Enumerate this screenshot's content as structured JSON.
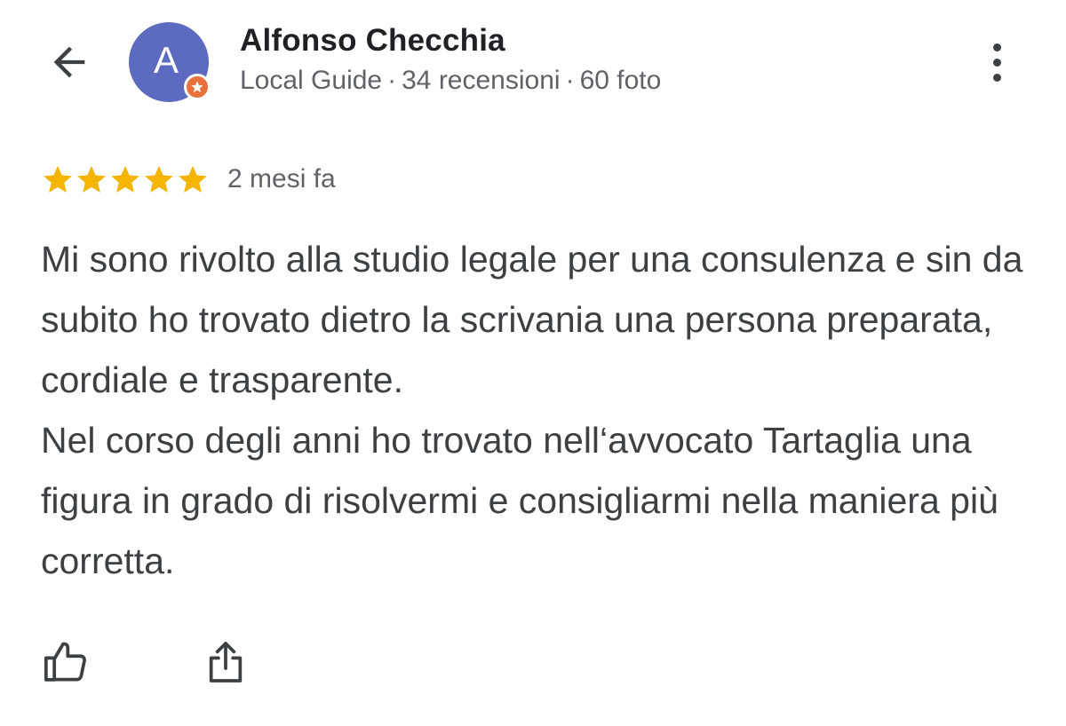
{
  "header": {
    "avatar_letter": "A",
    "author_name": "Alfonso Checchia",
    "meta": {
      "level": "Local Guide",
      "separator": "·",
      "reviews": "34 recensioni",
      "photos": "60 foto"
    },
    "icons": {
      "back": "arrow-back-icon",
      "more": "more-vert-icon",
      "badge": "local-guide-star-badge"
    }
  },
  "review": {
    "rating": 5,
    "max_rating": 5,
    "date": "2 mesi fa",
    "paragraphs": [
      "Mi sono rivolto alla studio legale per una consulenza e sin da subito ho trovato dietro la scrivania una persona preparata, cordiale e trasparente.",
      "Nel corso degli anni ho trovato nell‘avvocato Tartaglia una figura in grado di risolvermi e consigliarmi nella maniera più corretta."
    ]
  },
  "actions": {
    "like_icon": "thumb-up-icon",
    "share_icon": "share-icon"
  },
  "colors": {
    "avatar_bg": "#5c6bc0",
    "badge_bg": "#e8703a",
    "star": "#f4b400",
    "primary_text": "#202124",
    "secondary_text": "#5f6368"
  }
}
